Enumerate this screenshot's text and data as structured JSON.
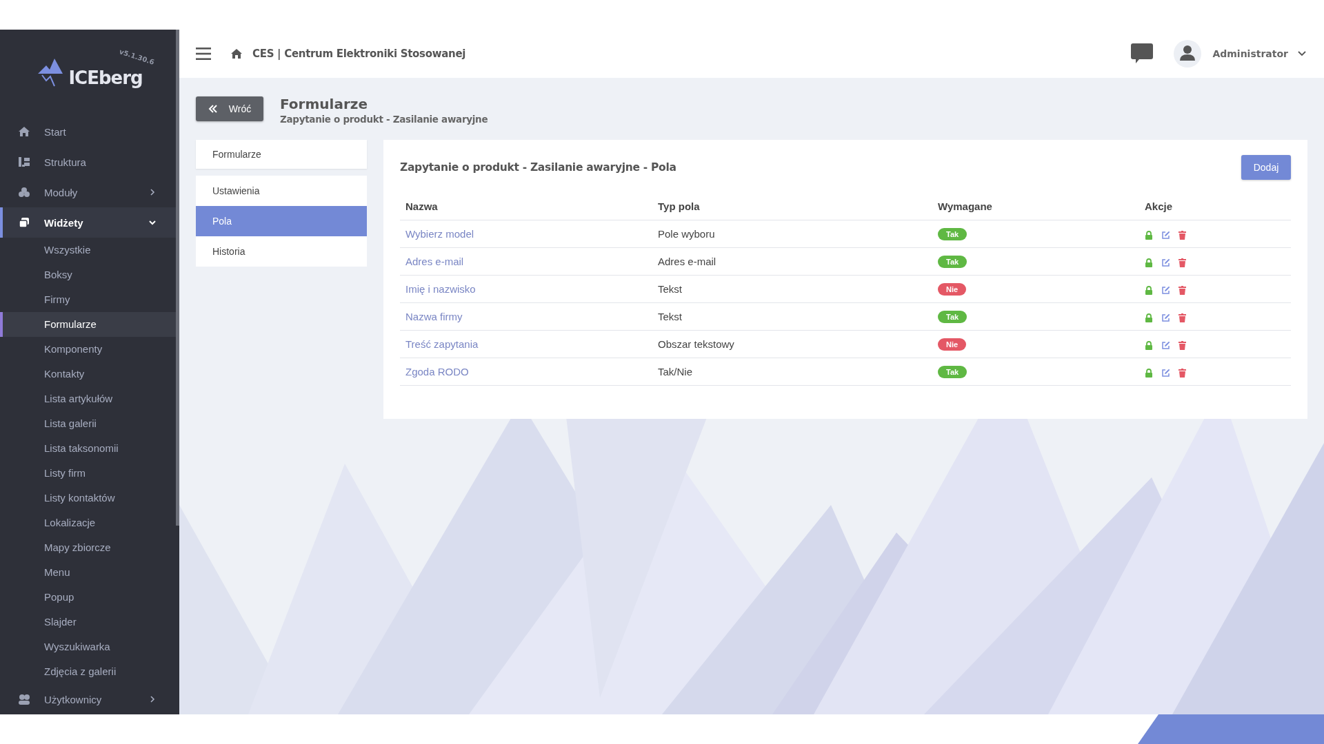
{
  "brand": {
    "logo": "ICEberg",
    "version": "v5.1.30.6"
  },
  "sidebar": {
    "items": [
      {
        "label": "Start",
        "kind": "link",
        "selected": false
      },
      {
        "label": "Struktura",
        "kind": "link",
        "selected": false
      },
      {
        "label": "Moduły",
        "kind": "group",
        "expanded": false,
        "selected": false
      },
      {
        "label": "Widżety",
        "kind": "group",
        "expanded": true,
        "selected": true,
        "children": [
          {
            "label": "Wszystkie",
            "selected": false
          },
          {
            "label": "Boksy",
            "selected": false
          },
          {
            "label": "Firmy",
            "selected": false
          },
          {
            "label": "Formularze",
            "selected": true
          },
          {
            "label": "Komponenty",
            "selected": false
          },
          {
            "label": "Kontakty",
            "selected": false
          },
          {
            "label": "Lista artykułów",
            "selected": false
          },
          {
            "label": "Lista galerii",
            "selected": false
          },
          {
            "label": "Lista taksonomii",
            "selected": false
          },
          {
            "label": "Listy firm",
            "selected": false
          },
          {
            "label": "Listy kontaktów",
            "selected": false
          },
          {
            "label": "Lokalizacje",
            "selected": false
          },
          {
            "label": "Mapy zbiorcze",
            "selected": false
          },
          {
            "label": "Menu",
            "selected": false
          },
          {
            "label": "Popup",
            "selected": false
          },
          {
            "label": "Slajder",
            "selected": false
          },
          {
            "label": "Wyszukiwarka",
            "selected": false
          },
          {
            "label": "Zdjęcia z galerii",
            "selected": false
          }
        ]
      },
      {
        "label": "Użytkownicy",
        "kind": "group",
        "expanded": false,
        "selected": false
      }
    ]
  },
  "topbar": {
    "breadcrumb": "CES | Centrum Elektroniki Stosowanej",
    "user": "Administrator"
  },
  "page": {
    "back": "Wróć",
    "title": "Formularze",
    "subtitle": "Zapytanie o produkt - Zasilanie awaryjne"
  },
  "tabs": [
    {
      "label": "Formularze",
      "selected": false
    },
    {
      "label": "Ustawienia",
      "selected": false
    },
    {
      "label": "Pola",
      "selected": true
    },
    {
      "label": "Historia",
      "selected": false
    }
  ],
  "card": {
    "title": "Zapytanie o produkt - Zasilanie awaryjne - Pola",
    "add_button": "Dodaj",
    "columns": [
      "Nazwa",
      "Typ pola",
      "Wymagane",
      "Akcje"
    ],
    "rows": [
      {
        "name": "Wybierz model",
        "type": "Pole wyboru",
        "required": true,
        "badge": "Tak"
      },
      {
        "name": "Adres e-mail",
        "type": "Adres e-mail",
        "required": true,
        "badge": "Tak"
      },
      {
        "name": "Imię i nazwisko",
        "type": "Tekst",
        "required": false,
        "badge": "Nie"
      },
      {
        "name": "Nazwa firmy",
        "type": "Tekst",
        "required": true,
        "badge": "Tak"
      },
      {
        "name": "Treść zapytania",
        "type": "Obszar tekstowy",
        "required": false,
        "badge": "Nie"
      },
      {
        "name": "Zgoda RODO",
        "type": "Tak/Nie",
        "required": true,
        "badge": "Tak"
      }
    ]
  }
}
